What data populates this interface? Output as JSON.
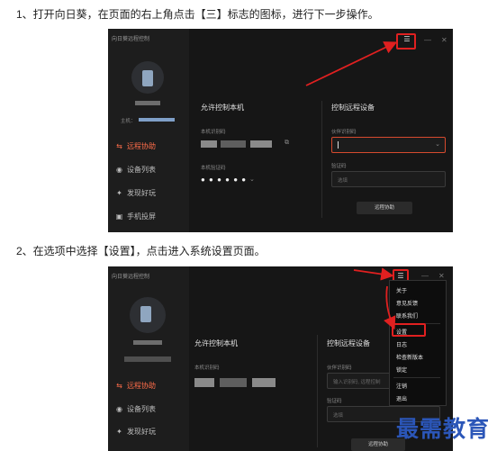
{
  "steps": {
    "step1": "1、打开向日葵，在页面的右上角点击【三】标志的图标，进行下一步操作。",
    "step2": "2、在选项中选择【设置】，点击进入系统设置页面。"
  },
  "app": {
    "window_title": "向日葵远程控制",
    "host_label": "主机：",
    "nav": [
      {
        "label": "远程协助",
        "icon": "remote-assist-icon"
      },
      {
        "label": "设备列表",
        "icon": "device-list-icon"
      },
      {
        "label": "发现好玩",
        "icon": "discover-icon"
      },
      {
        "label": "手机投屏",
        "icon": "phone-cast-icon"
      }
    ],
    "allow_control_title": "允许控制本机",
    "local_id_label": "本机识别码",
    "local_code_label": "本机验证码",
    "local_code_mask": "● ● ● ● ● ●",
    "remote_title": "控制远程设备",
    "partner_id_label": "伙伴识别码",
    "partner_id_placeholder": "输入识别码, 远程控制",
    "verify_label": "验证码",
    "verify_placeholder": "选填",
    "remote_button": "远程协助",
    "menu_icon_glyph": "☰",
    "minimize_glyph": "—",
    "close_glyph": "✕"
  },
  "menu": {
    "items": [
      "关于",
      "意见反馈",
      "联系我们",
      "设置",
      "日志",
      "检查新版本",
      "锁定",
      "注销",
      "退出"
    ],
    "selected": "设置"
  },
  "watermark": "最需教育",
  "colors": {
    "highlight": "#e02020",
    "accent": "#ff6d4a",
    "watermark": "#2b56b8"
  }
}
